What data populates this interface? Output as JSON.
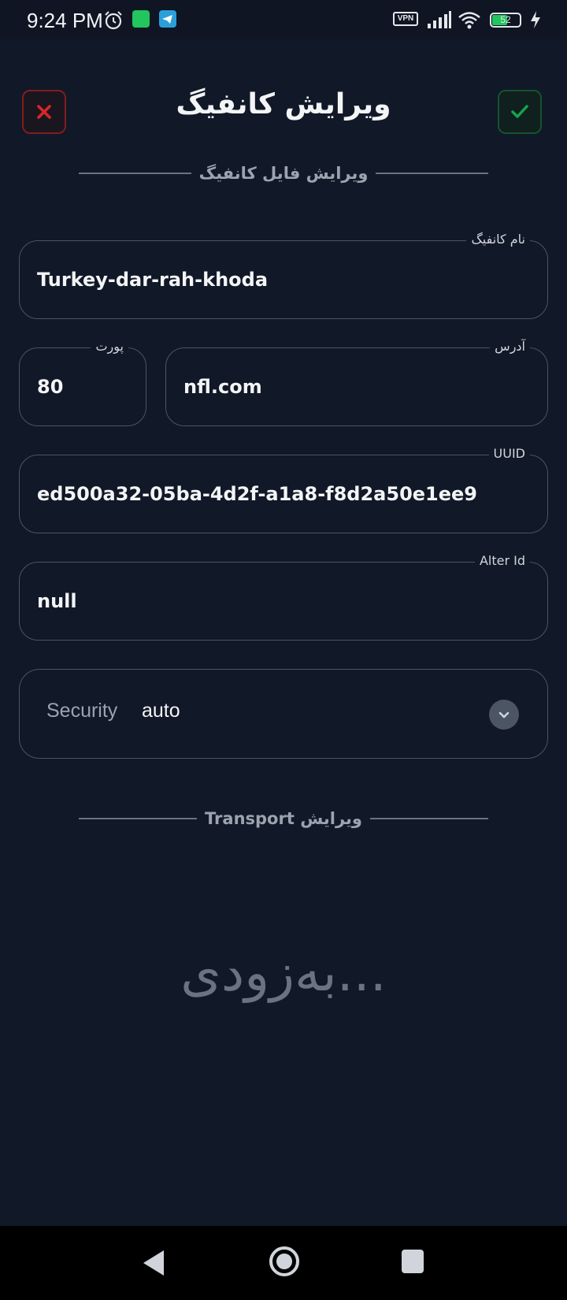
{
  "status_bar": {
    "time": "9:24 PM",
    "vpn_label": "VPN",
    "battery_level": "52",
    "icons": [
      "alarm-icon",
      "notification-icon",
      "telegram-icon",
      "vpn-icon",
      "signal-icon",
      "wifi-icon",
      "battery-icon",
      "charging-icon"
    ]
  },
  "header": {
    "title": "ویرایش کانفیگ",
    "close_icon": "close-icon",
    "save_icon": "check-icon"
  },
  "colors": {
    "background": "#111827",
    "close_accent": "#dc2626",
    "save_accent": "#16a34a",
    "field_border": "#4b5563"
  },
  "sections": {
    "config_file": "ویرایش فایل کانفیگ",
    "transport": "ویرایش Transport"
  },
  "form": {
    "config_name": {
      "label": "نام کانفیگ",
      "value": "Turkey-dar-rah-khoda"
    },
    "port": {
      "label": "پورت",
      "value": "80"
    },
    "address": {
      "label": "آدرس",
      "value": "nfl.com"
    },
    "uuid": {
      "label": "UUID",
      "value": "ed500a32-05ba-4d2f-a1a8-f8d2a50e1ee9"
    },
    "alter_id": {
      "label": "Alter Id",
      "value": "null"
    },
    "security": {
      "label": "Security",
      "value": "auto"
    }
  },
  "coming_soon": "...به‌زودی"
}
